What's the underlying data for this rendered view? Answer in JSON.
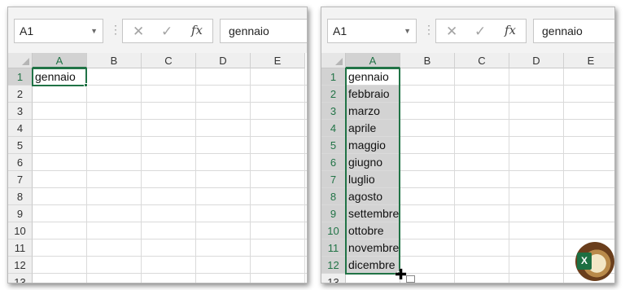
{
  "left": {
    "name_box": "A1",
    "formula": "gennaio",
    "columns": [
      "A",
      "B",
      "C",
      "D",
      "E"
    ],
    "rows": [
      "1",
      "2",
      "3",
      "4",
      "5",
      "6",
      "7",
      "8",
      "9",
      "10",
      "11",
      "12",
      "13"
    ],
    "cells": [
      "gennaio"
    ]
  },
  "right": {
    "name_box": "A1",
    "formula": "gennaio",
    "columns": [
      "A",
      "B",
      "C",
      "D",
      "E"
    ],
    "rows": [
      "1",
      "2",
      "3",
      "4",
      "5",
      "6",
      "7",
      "8",
      "9",
      "10",
      "11",
      "12",
      "13"
    ],
    "cells": [
      "gennaio",
      "febbraio",
      "marzo",
      "aprile",
      "maggio",
      "giugno",
      "luglio",
      "agosto",
      "settembre",
      "ottobre",
      "novembre",
      "dicembre"
    ]
  },
  "icons": {
    "cancel": "✕",
    "enter": "✓",
    "fx": "fx",
    "dropdown": "▼",
    "separator": "⋮",
    "cursor": "✚",
    "excel_logo_letter": "X"
  },
  "colors": {
    "selection": "#217346",
    "selected_fill": "#d3d3d3"
  }
}
